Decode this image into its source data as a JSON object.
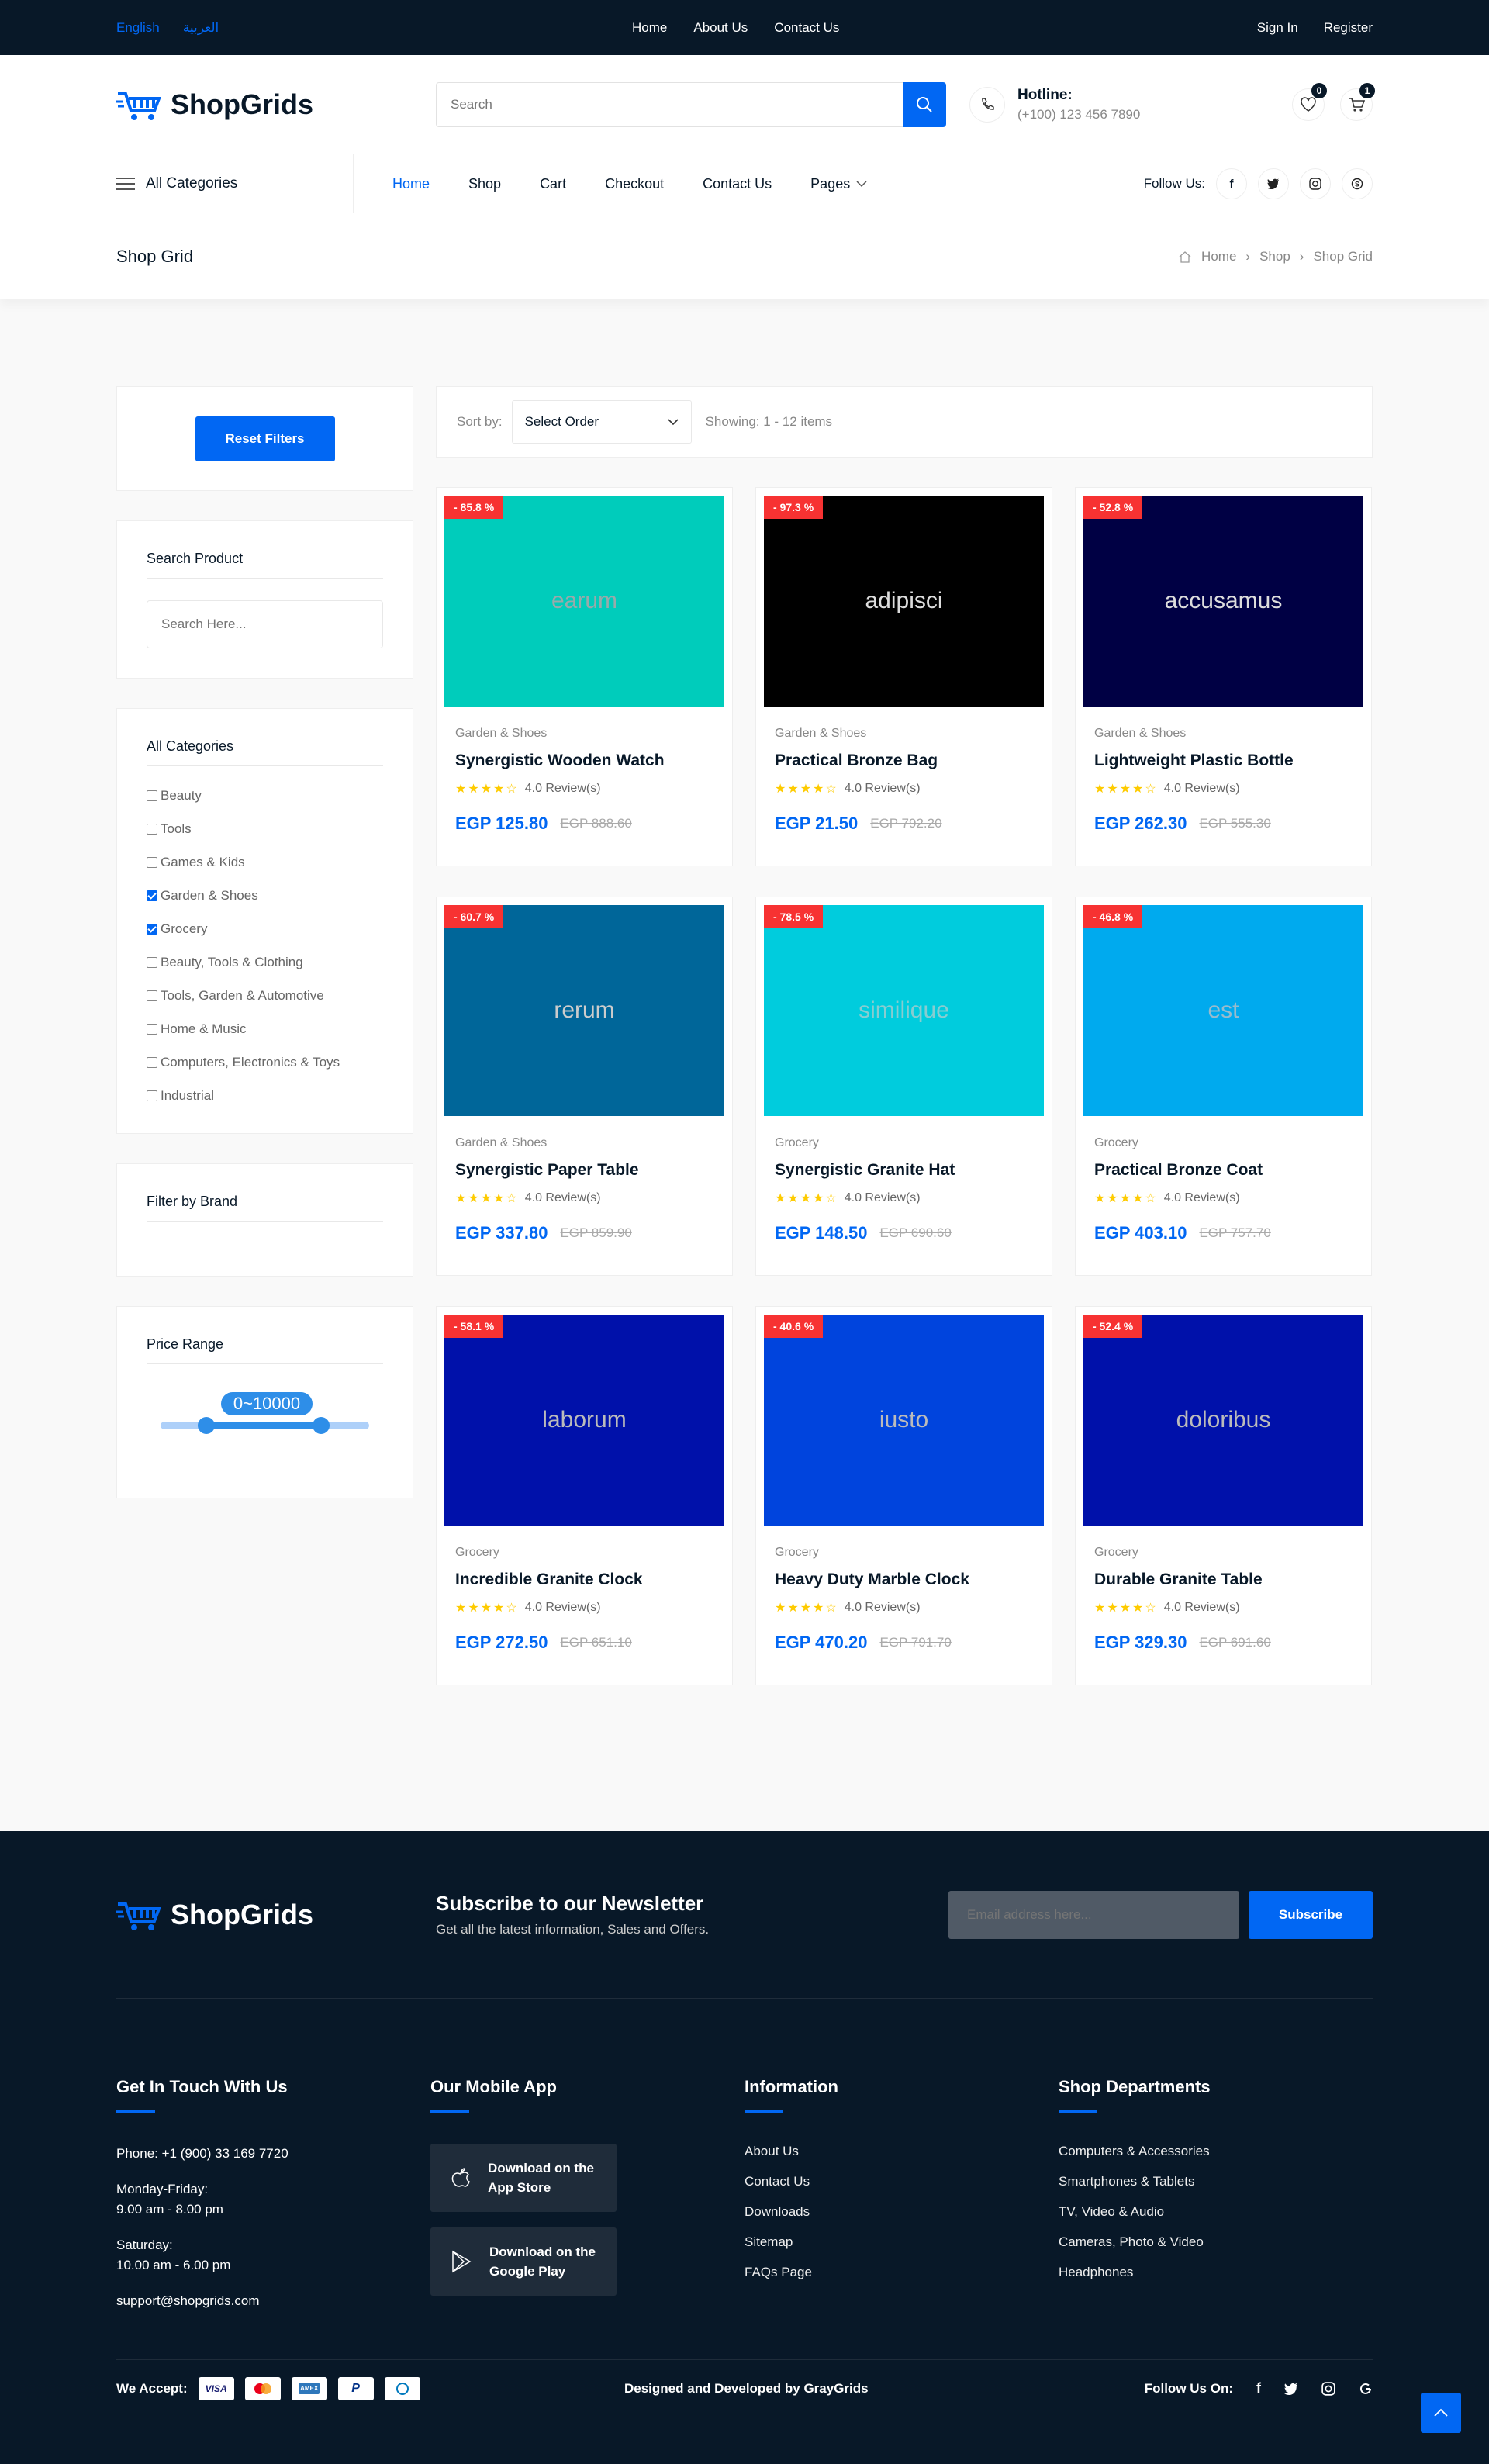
{
  "topbar": {
    "lang_en": "English",
    "lang_ar": "العربية",
    "menu": [
      "Home",
      "About Us",
      "Contact Us"
    ],
    "signin": "Sign In",
    "register": "Register"
  },
  "header": {
    "logo": "ShopGrids",
    "search_placeholder": "Search",
    "hotline_title": "Hotline:",
    "hotline_number": "(+100) 123 456 7890",
    "wishlist_count": "0",
    "cart_count": "1"
  },
  "nav": {
    "all_categories": "All Categories",
    "items": [
      "Home",
      "Shop",
      "Cart",
      "Checkout",
      "Contact Us",
      "Pages"
    ],
    "follow": "Follow Us:"
  },
  "breadcrumb": {
    "title": "Shop Grid",
    "items": [
      "Home",
      "Shop",
      "Shop Grid"
    ]
  },
  "sidebar": {
    "reset": "Reset Filters",
    "search_title": "Search Product",
    "search_placeholder": "Search Here...",
    "cat_title": "All Categories",
    "categories": [
      {
        "label": "Beauty",
        "checked": false
      },
      {
        "label": "Tools",
        "checked": false
      },
      {
        "label": "Games & Kids",
        "checked": false
      },
      {
        "label": "Garden & Shoes",
        "checked": true
      },
      {
        "label": "Grocery",
        "checked": true
      },
      {
        "label": "Beauty, Tools & Clothing",
        "checked": false
      },
      {
        "label": "Tools, Garden & Automotive",
        "checked": false
      },
      {
        "label": "Home & Music",
        "checked": false
      },
      {
        "label": "Computers, Electronics & Toys",
        "checked": false
      },
      {
        "label": "Industrial",
        "checked": false
      }
    ],
    "brand_title": "Filter by Brand",
    "price_title": "Price Range",
    "price_value": "0~10000"
  },
  "sort": {
    "label": "Sort by:",
    "selected": "Select Order",
    "showing": "Showing: 1 - 12 items"
  },
  "products": [
    {
      "img_text": "earum",
      "color": "#00ccbb",
      "text_color": "#9aa",
      "discount": "- 85.8 %",
      "category": "Garden & Shoes",
      "name": "Synergistic Wooden Watch",
      "reviews": "4.0 Review(s)",
      "price": "EGP 125.80",
      "old": "EGP 888.60"
    },
    {
      "img_text": "adipisci",
      "color": "#000000",
      "text_color": "#ddd",
      "discount": "- 97.3 %",
      "category": "Garden & Shoes",
      "name": "Practical Bronze Bag",
      "reviews": "4.0 Review(s)",
      "price": "EGP 21.50",
      "old": "EGP 792.20"
    },
    {
      "img_text": "accusamus",
      "color": "#000044",
      "text_color": "#ddd",
      "discount": "- 52.8 %",
      "category": "Garden & Shoes",
      "name": "Lightweight Plastic Bottle",
      "reviews": "4.0 Review(s)",
      "price": "EGP 262.30",
      "old": "EGP 555.30"
    },
    {
      "img_text": "rerum",
      "color": "#006699",
      "text_color": "#ccc",
      "discount": "- 60.7 %",
      "category": "Garden & Shoes",
      "name": "Synergistic Paper Table",
      "reviews": "4.0 Review(s)",
      "price": "EGP 337.80",
      "old": "EGP 859.90"
    },
    {
      "img_text": "similique",
      "color": "#00ccdd",
      "text_color": "#88ccd0",
      "discount": "- 78.5 %",
      "category": "Grocery",
      "name": "Synergistic Granite Hat",
      "reviews": "4.0 Review(s)",
      "price": "EGP 148.50",
      "old": "EGP 690.60"
    },
    {
      "img_text": "est",
      "color": "#00aaee",
      "text_color": "#9bc",
      "discount": "- 46.8 %",
      "category": "Grocery",
      "name": "Practical Bronze Coat",
      "reviews": "4.0 Review(s)",
      "price": "EGP 403.10",
      "old": "EGP 757.70"
    },
    {
      "img_text": "laborum",
      "color": "#0011aa",
      "text_color": "#bbb",
      "discount": "- 58.1 %",
      "category": "Grocery",
      "name": "Incredible Granite Clock",
      "reviews": "4.0 Review(s)",
      "price": "EGP 272.50",
      "old": "EGP 651.10"
    },
    {
      "img_text": "iusto",
      "color": "#0044dd",
      "text_color": "#bbb",
      "discount": "- 40.6 %",
      "category": "Grocery",
      "name": "Heavy Duty Marble Clock",
      "reviews": "4.0 Review(s)",
      "price": "EGP 470.20",
      "old": "EGP 791.70"
    },
    {
      "img_text": "doloribus",
      "color": "#0011aa",
      "text_color": "#bbb",
      "discount": "- 52.4 %",
      "category": "Grocery",
      "name": "Durable Granite Table",
      "reviews": "4.0 Review(s)",
      "price": "EGP 329.30",
      "old": "EGP 691.60"
    }
  ],
  "footer": {
    "logo": "ShopGrids",
    "news_title": "Subscribe to our Newsletter",
    "news_sub": "Get all the latest information, Sales and Offers.",
    "email_placeholder": "Email address here...",
    "subscribe": "Subscribe",
    "contact_title": "Get In Touch With Us",
    "phone": "Phone: +1 (900) 33 169 7720",
    "weekday_label": "Monday-Friday:",
    "weekday_hours": "9.00 am - 8.00 pm",
    "sat_label": "Saturday:",
    "sat_hours": "10.00 am - 6.00 pm",
    "email": "support@shopgrids.com",
    "app_title": "Our Mobile App",
    "app_store": [
      "Download on the",
      "App Store"
    ],
    "google_play": [
      "Download on the",
      "Google Play"
    ],
    "info_title": "Information",
    "info_links": [
      "About Us",
      "Contact Us",
      "Downloads",
      "Sitemap",
      "FAQs Page"
    ],
    "dept_title": "Shop Departments",
    "dept_links": [
      "Computers & Accessories",
      "Smartphones & Tablets",
      "TV, Video & Audio",
      "Cameras, Photo & Video",
      "Headphones"
    ],
    "we_accept": "We Accept:",
    "payment_icons": [
      "visa-icon",
      "mastercard-icon",
      "amex-icon",
      "paypal-icon",
      "diners-icon"
    ],
    "designed": "Designed and Developed by GrayGrids",
    "follow": "Follow Us On:"
  },
  "colors": {
    "primary": "#0167f3",
    "dark": "#081828",
    "discount": "#f73232",
    "star": "#fecb00"
  }
}
